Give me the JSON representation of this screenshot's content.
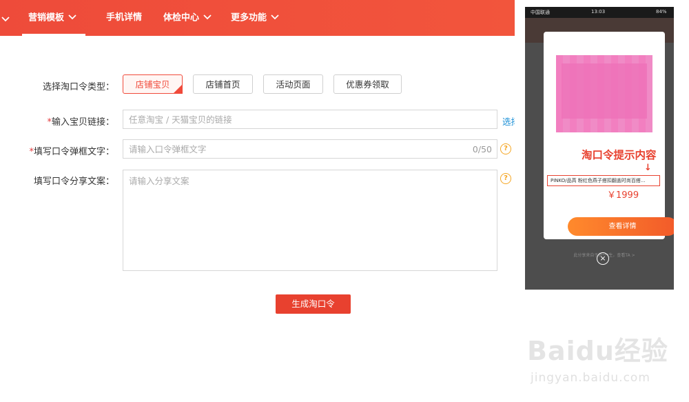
{
  "nav": {
    "items": [
      "营销模板",
      "手机详情",
      "体检中心",
      "更多功能"
    ]
  },
  "form": {
    "type_label": "选择淘口令类型：",
    "type_options": [
      "店铺宝贝",
      "店铺首页",
      "活动页面",
      "优惠券领取"
    ],
    "selected_type": "店铺宝贝",
    "link_label": "输入宝贝链接：",
    "link_placeholder": "任意淘宝 / 天猫宝贝的链接",
    "link_side": "选择",
    "popup_label": "填写口令弹框文字：",
    "popup_placeholder": "请输入口令弹框文字",
    "popup_count": "0/50",
    "share_label": "填写口令分享文案：",
    "share_placeholder": "请输入分享文案",
    "required_mark": "*",
    "generate_button": "生成淘口令",
    "help_icon": "?"
  },
  "phone": {
    "carrier": "中国联通",
    "time": "13:03",
    "battery": "84%",
    "annotation": "淘口令提示内容",
    "price": "￥1999",
    "arrow": "↓",
    "product_title": "PINKO/品高 粉红色燕子搭扣翻盖时尚百搭...",
    "detail_button": "查看详情",
    "share_from": "此分享来自于脱***生，查看TA >",
    "close": "×"
  },
  "watermark": {
    "brand": "Baidu经验",
    "url": "jingyan.baidu.com"
  },
  "colors": {
    "brand_red": "#f04a3a",
    "orange": "#ff8a2c",
    "help_orange": "#f5a623"
  }
}
